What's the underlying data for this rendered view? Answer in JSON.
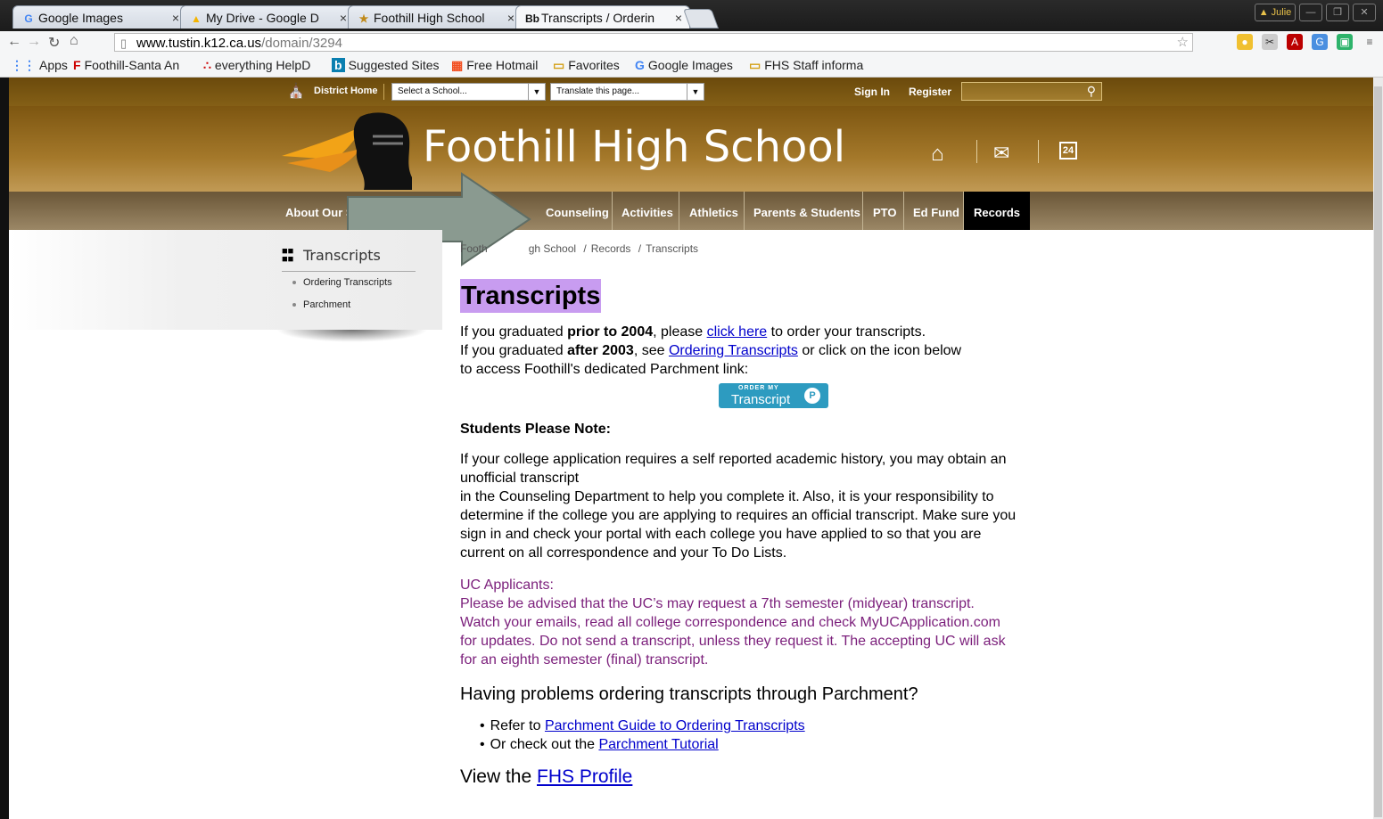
{
  "browser": {
    "tabs": [
      {
        "favicon": "G",
        "label": "Google Images"
      },
      {
        "favicon": "▲",
        "label": "My Drive - Google D"
      },
      {
        "favicon": "★",
        "label": "Foothill High School"
      },
      {
        "favicon": "Bb",
        "label": "Transcripts / Orderin"
      }
    ],
    "user_badge": "Julie",
    "url_host": "www.tustin.k12.ca.us",
    "url_path": "/domain/3294",
    "bookmarks": [
      {
        "icon": "apps-icon",
        "glyph": "⋮⋮",
        "label": "Apps"
      },
      {
        "icon": "foothill-icon",
        "glyph": "F",
        "label": "Foothill-Santa An"
      },
      {
        "icon": "helpdesk-icon",
        "glyph": "∴",
        "label": "everything HelpD"
      },
      {
        "icon": "bing-icon",
        "glyph": "b",
        "label": "Suggested Sites"
      },
      {
        "icon": "windows-icon",
        "glyph": "▦",
        "label": "Free Hotmail"
      },
      {
        "icon": "folder-icon",
        "glyph": "▭",
        "label": "Favorites"
      },
      {
        "icon": "google-icon",
        "glyph": "G",
        "label": "Google Images"
      },
      {
        "icon": "folder-icon",
        "glyph": "▭",
        "label": "FHS Staff informa"
      }
    ]
  },
  "site": {
    "district_home": "District Home",
    "school_select": "Select a School...",
    "translate_select": "Translate this page...",
    "sign_in": "Sign In",
    "register": "Register",
    "school_name": "Foothill High School",
    "calendar_day": "24",
    "nav": [
      "About Our Scho",
      "Counseling",
      "Activities",
      "Athletics",
      "Parents & Students",
      "PTO",
      "Ed Fund",
      "Records"
    ],
    "colors": {
      "brand_gold": "#9c7222",
      "nav_active": "#000000",
      "title_highlight": "#c89cf0",
      "arrow": "#8a9a90"
    }
  },
  "sidebar": {
    "title": "Transcripts",
    "items": [
      "Ordering Transcripts",
      "Parchment"
    ]
  },
  "content": {
    "breadcrumb": {
      "part1": "Footh",
      "part2": "gh School",
      "sep1": "/",
      "records": "Records",
      "sep2": "/",
      "current": "Transcripts"
    },
    "title": "Transcripts",
    "line1": {
      "a": "If you graduated ",
      "b": "prior to 2004",
      "c": ", please ",
      "link": "click here",
      "d": " to order your transcripts."
    },
    "line2": {
      "a": "If you graduated ",
      "b": "after 2003",
      "c": ", see ",
      "link": "Ordering Transcripts",
      "d": " or click on the icon below"
    },
    "line3": "to access Foothill's  dedicated Parchment link:",
    "badge": {
      "small": "ORDER MY",
      "big": "Transcript",
      "p": "P"
    },
    "note_heading": "Students Please Note:",
    "note_lines": [
      "If your college application requires a self reported academic history, you may obtain an",
      "unofficial transcript",
      "in the Counseling Department to help you complete it. Also, it is your responsibility to",
      "determine if the college you are applying to requires an official transcript. Make sure you",
      "sign in and check your portal with each college you have applied to so that you are",
      "current on all correspondence and your To Do Lists."
    ],
    "uc_lines": [
      "UC Applicants:",
      "Please be advised that the UC’s may request a 7th semester (midyear) transcript.",
      "Watch your emails, read all college correspondence and check MyUCApplication.com",
      "for updates. Do not send a transcript, unless they request it. The accepting UC will ask",
      "for an eighth semester (final) transcript."
    ],
    "problems_heading": "Having problems ordering transcripts through Parchment?",
    "bullet1": {
      "a": "Refer to ",
      "link": "Parchment Guide to Ordering Transcripts"
    },
    "bullet2": {
      "a": "Or check out the ",
      "link": "Parchment Tutorial"
    },
    "profile": {
      "a": "View the ",
      "link": "FHS Profile"
    }
  }
}
